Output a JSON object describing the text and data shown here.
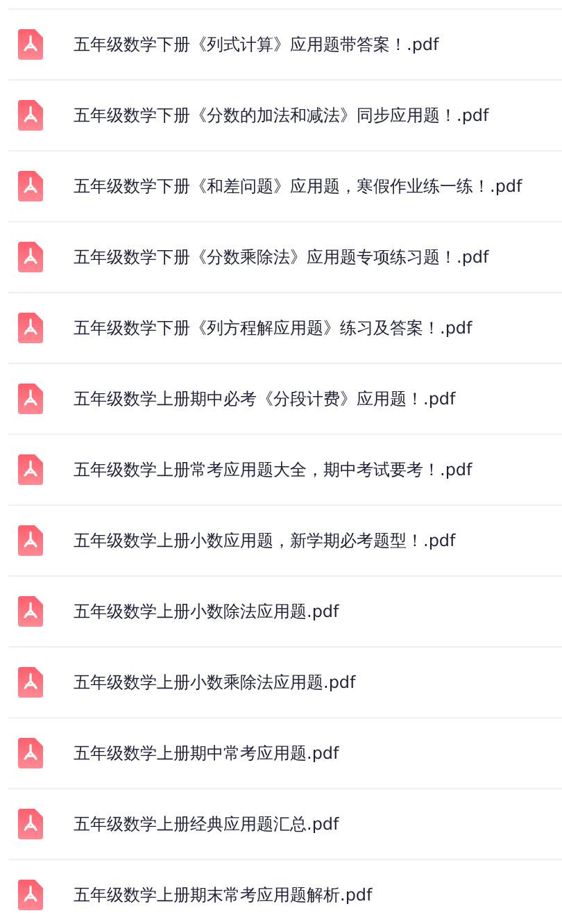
{
  "files": [
    {
      "name": "五年级数学下册《列式计算》应用题带答案！.pdf"
    },
    {
      "name": "五年级数学下册《分数的加法和减法》同步应用题！.pdf"
    },
    {
      "name": "五年级数学下册《和差问题》应用题，寒假作业练一练！.pdf"
    },
    {
      "name": "五年级数学下册《分数乘除法》应用题专项练习题！.pdf"
    },
    {
      "name": "五年级数学下册《列方程解应用题》练习及答案！.pdf"
    },
    {
      "name": "五年级数学上册期中必考《分段计费》应用题！.pdf"
    },
    {
      "name": "五年级数学上册常考应用题大全，期中考试要考！.pdf"
    },
    {
      "name": "五年级数学上册小数应用题，新学期必考题型！.pdf"
    },
    {
      "name": "五年级数学上册小数除法应用题.pdf"
    },
    {
      "name": "五年级数学上册小数乘除法应用题.pdf"
    },
    {
      "name": "五年级数学上册期中常考应用题.pdf"
    },
    {
      "name": "五年级数学上册经典应用题汇总.pdf"
    },
    {
      "name": "五年级数学上册期末常考应用题解析.pdf"
    }
  ]
}
